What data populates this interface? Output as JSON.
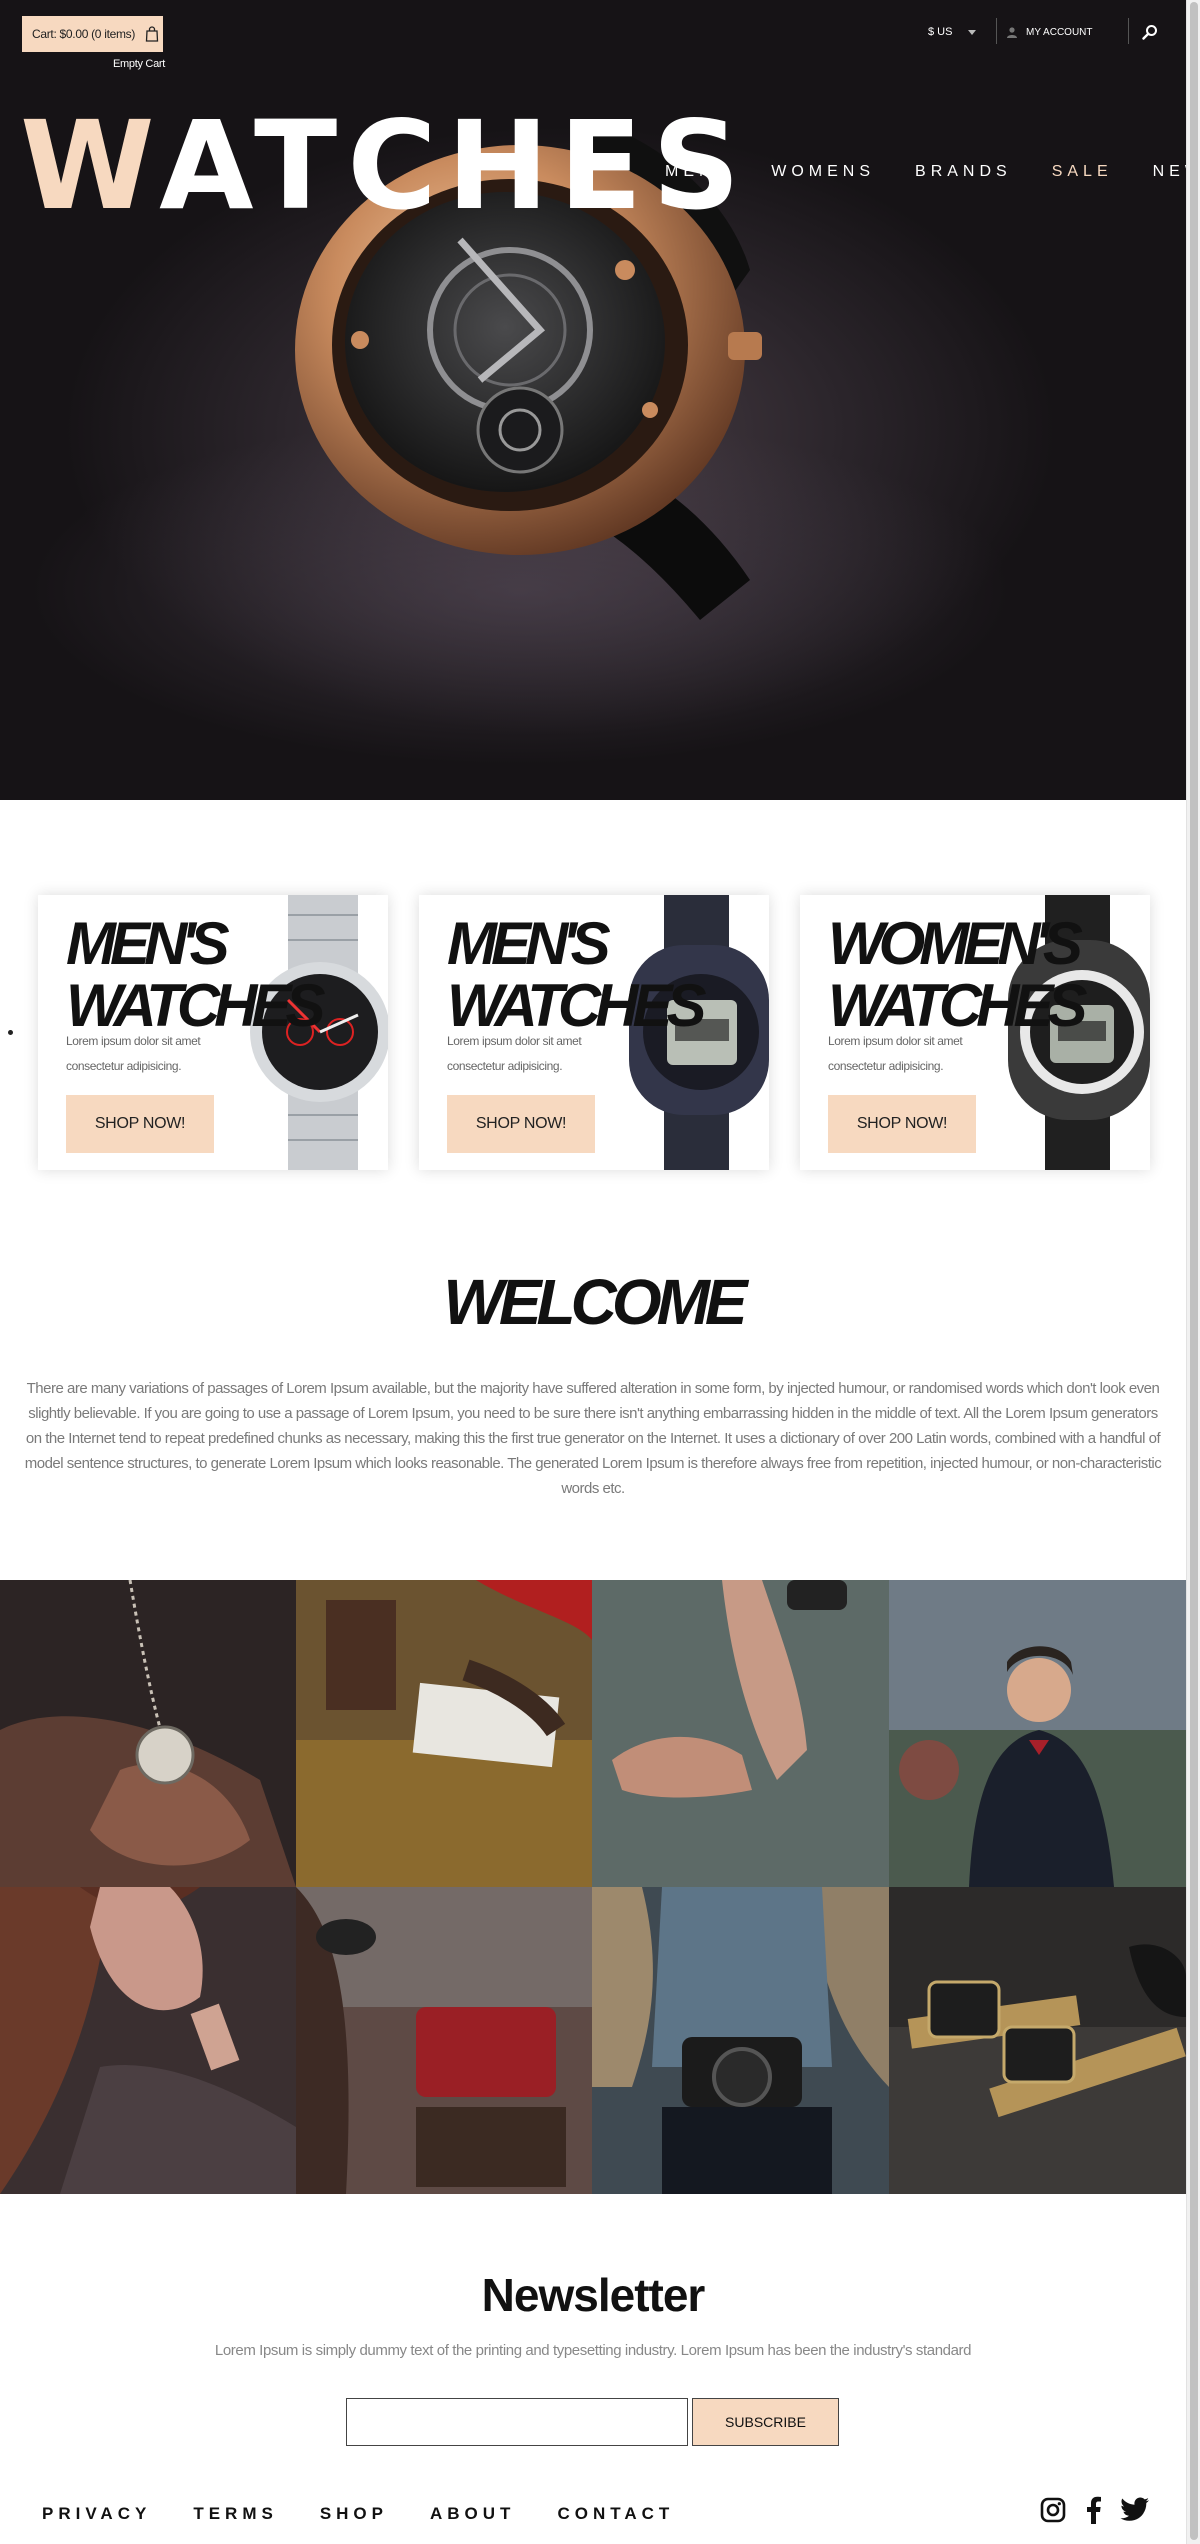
{
  "header": {
    "cart_label": "Cart: $0.00 (0 items)",
    "cart_status": "Empty Cart",
    "currency": "$ US",
    "account_label": "MY ACCOUNT"
  },
  "hero": {
    "title_first": "W",
    "title_rest": "ATCHES"
  },
  "nav": [
    {
      "label": "MENS"
    },
    {
      "label": "WOMENS"
    },
    {
      "label": "BRANDS"
    },
    {
      "label": "SALE"
    },
    {
      "label": "NEWS"
    }
  ],
  "promos": [
    {
      "line1": "MEN'S",
      "line2": "WATCHES",
      "desc": "Lorem ipsum dolor sit amet consectetur adipisicing.",
      "button": "SHOP NOW!"
    },
    {
      "line1": "MEN'S",
      "line2": "WATCHES",
      "desc": "Lorem ipsum dolor sit amet consectetur adipisicing.",
      "button": "SHOP NOW!"
    },
    {
      "line1": "WOMEN'S",
      "line2": "WATCHES",
      "desc": "Lorem ipsum dolor sit amet consectetur adipisicing.",
      "button": "SHOP NOW!"
    }
  ],
  "welcome": {
    "title": "WELCOME",
    "text": "There are many variations of passages of Lorem Ipsum available, but the majority have suffered alteration in some form, by injected humour, or randomised words which don't look even slightly believable. If you are going to use a passage of Lorem Ipsum, you need to be sure there isn't anything embarrassing hidden in the middle of text. All the Lorem Ipsum generators on the Internet tend to repeat predefined chunks as necessary, making this the first true generator on the Internet. It uses a dictionary of over 200 Latin words, combined with a handful of model sentence structures, to generate Lorem Ipsum which looks reasonable. The generated Lorem Ipsum is therefore always free from repetition, injected humour, or non-characteristic words etc."
  },
  "newsletter": {
    "title": "Newsletter",
    "subtitle": "Lorem Ipsum is simply dummy text of the printing and typesetting industry. Lorem Ipsum has been the industry's standard",
    "button": "SUBSCRIBE",
    "input_value": ""
  },
  "footer": {
    "links": [
      {
        "label": "PRIVACY"
      },
      {
        "label": "TERMS"
      },
      {
        "label": "SHOP"
      },
      {
        "label": "ABOUT"
      },
      {
        "label": "CONTACT"
      }
    ],
    "socials": [
      "instagram-icon",
      "facebook-icon",
      "twitter-icon"
    ]
  },
  "colors": {
    "accent": "#f7d9c0",
    "hero_bg": "#1c181c",
    "text_dark": "#111111",
    "text_muted": "#7a7a7a"
  }
}
